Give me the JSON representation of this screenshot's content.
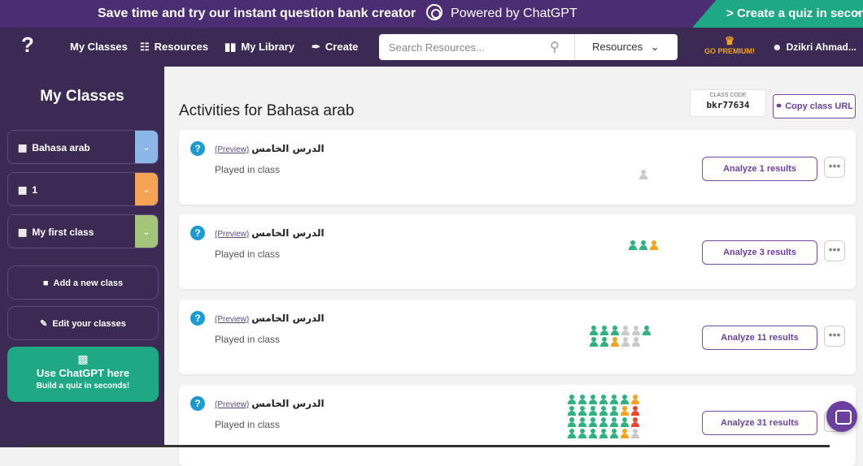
{
  "banner": {
    "message": "Save time and try our instant question bank creator",
    "powered": "Powered by ChatGPT",
    "cta": "Create a quiz in seconds",
    "cta_arrow": ">",
    "close": "×"
  },
  "nav": {
    "logo": "?",
    "items": [
      {
        "label": "My Classes",
        "icon": ""
      },
      {
        "label": "Resources",
        "icon": "binoculars-icon"
      },
      {
        "label": "My Library",
        "icon": "book-icon"
      },
      {
        "label": "Create",
        "icon": "pen-icon"
      }
    ],
    "search_placeholder": "Search Resources...",
    "search_scope": "Resources",
    "premium": "GO PREMIUM!",
    "user": "Dzikri Ahmad..."
  },
  "sidebar": {
    "title": "My Classes",
    "classes": [
      {
        "name": "Bahasa arab",
        "color": "#8ab6e8"
      },
      {
        "name": "1",
        "color": "#f5a455"
      },
      {
        "name": "My first class",
        "color": "#a4c47a"
      }
    ],
    "add_class": "Add a new class",
    "edit_classes": "Edit your classes",
    "gpt_title": "Use ChatGPT here",
    "gpt_sub": "Build a quiz in seconds!"
  },
  "main": {
    "title": "Activities for Bahasa arab",
    "class_code_caption": "CLASS CODE",
    "class_code": "bkr77634",
    "copy_url": "Copy class URL",
    "activities": [
      {
        "title": "الدرس الخامس",
        "preview": "(Preview)",
        "status": "Played in class",
        "analyze": "Analyze 1 results",
        "players": [
          "gray"
        ]
      },
      {
        "title": "الدرس الخامس",
        "preview": "(Preview)",
        "status": "Played in class",
        "analyze": "Analyze 3 results",
        "players": [
          "green",
          "green",
          "orange"
        ]
      },
      {
        "title": "الدرس الخامس",
        "preview": "(Preview)",
        "status": "Played in class",
        "analyze": "Analyze 11 results",
        "players": [
          "green",
          "green",
          "green",
          "gray",
          "gray",
          "green",
          "green",
          "green",
          "orange",
          "gray",
          "gray"
        ]
      },
      {
        "title": "الدرس الخامس",
        "preview": "(Preview)",
        "status": "Played in class",
        "analyze": "Analyze 31 results",
        "players": [
          "green",
          "green",
          "green",
          "green",
          "green",
          "green",
          "orange",
          "green",
          "green",
          "green",
          "green",
          "green",
          "orange",
          "red",
          "green",
          "green",
          "green",
          "green",
          "green",
          "green",
          "red",
          "green",
          "green",
          "green",
          "green",
          "green",
          "orange",
          "gray"
        ]
      }
    ]
  },
  "colors": {
    "green": "#2fb37e",
    "orange": "#f5a21d",
    "red": "#e8452c",
    "gray": "#c9c9c9"
  }
}
